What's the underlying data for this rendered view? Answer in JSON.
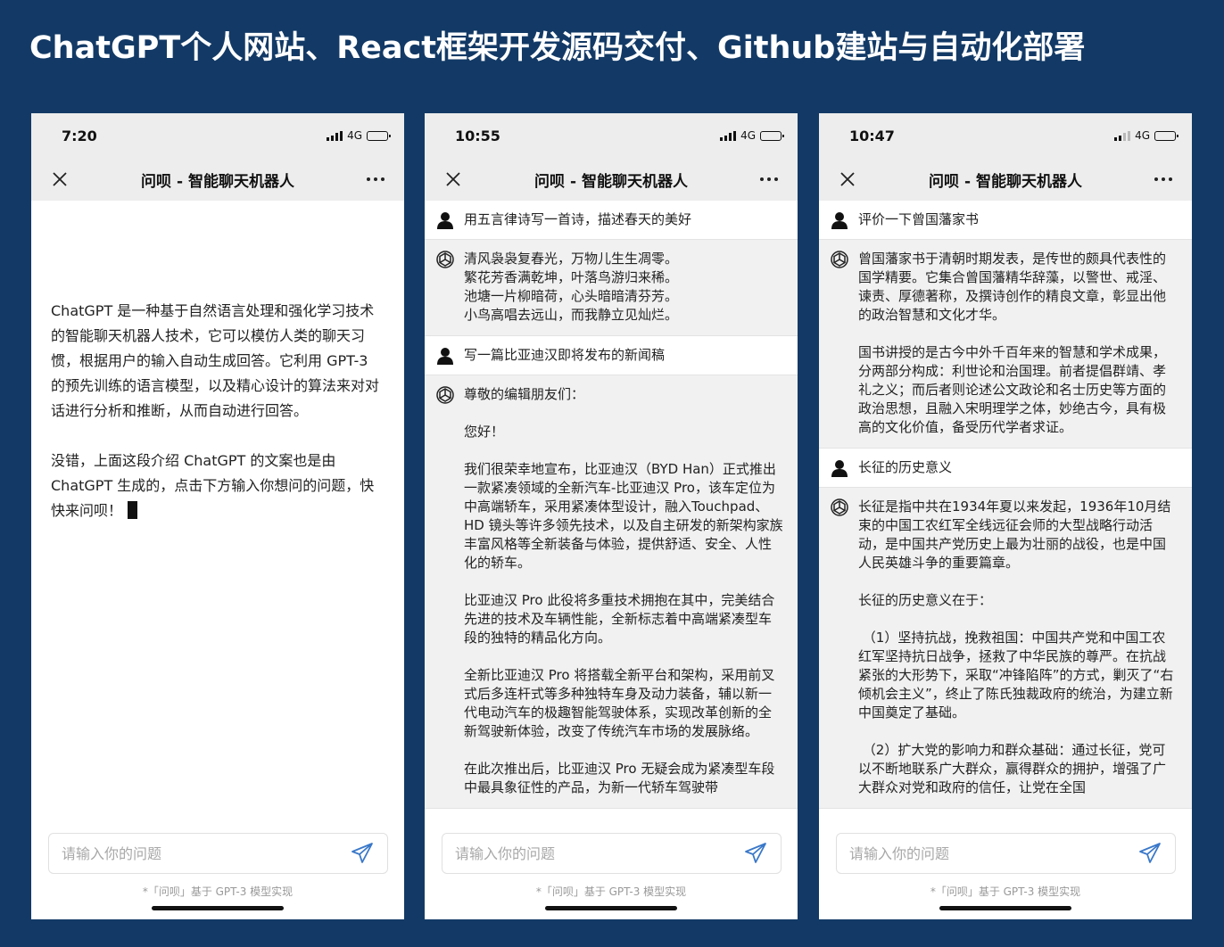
{
  "banner": {
    "title": "ChatGPT个人网站、React框架开发源码交付、Github建站与自动化部署"
  },
  "phones": [
    {
      "time": "7:20",
      "network": "4G",
      "signal": "full",
      "battery_level": 0.4,
      "nav_title": "问呗 - 智能聊天机器人",
      "intro": [
        "ChatGPT 是一种基于自然语言处理和强化学习技术的智能聊天机器人技术，它可以模仿人类的聊天习惯，根据用户的输入自动生成回答。它利用 GPT-3 的预先训练的语言模型，以及精心设计的算法来对对话进行分析和推断，从而自动进行回答。",
        "没错，上面这段介绍 ChatGPT 的文案也是由 ChatGPT 生成的，点击下方输入你想问的问题，快快来问呗！"
      ],
      "input_placeholder": "请输入你的问题",
      "footnote": "*「问呗」基于 GPT-3 模型实现"
    },
    {
      "time": "10:55",
      "network": "4G",
      "signal": "full",
      "battery_level": 0.35,
      "nav_title": "问呗 - 智能聊天机器人",
      "messages": [
        {
          "role": "user",
          "paragraphs": [
            "用五言律诗写一首诗，描述春天的美好"
          ]
        },
        {
          "role": "bot",
          "paragraphs": [
            "清风袅袅复春光，万物儿生生凋零。\n繁花芳香满乾坤，叶落鸟游归来稀。\n池塘一片柳暗荷，心头暗暗清芬芳。\n小鸟高唱去远山，而我静立见灿烂。"
          ]
        },
        {
          "role": "user",
          "paragraphs": [
            "写一篇比亚迪汉即将发布的新闻稿"
          ]
        },
        {
          "role": "bot",
          "paragraphs": [
            "尊敬的编辑朋友们：",
            "您好！",
            "我们很荣幸地宣布，比亚迪汉（BYD Han）正式推出一款紧凑领域的全新汽车-比亚迪汉 Pro，该车定位为中高端轿车，采用紧凑体型设计，融入Touchpad、HD 镜头等许多领先技术，以及自主研发的新架构家族丰富风格等全新装备与体验，提供舒适、安全、人性化的轿车。",
            "比亚迪汉 Pro 此役将多重技术拥抱在其中，完美结合先进的技术及车辆性能，全新标志着中高端紧凑型车段的独特的精品化方向。",
            "全新比亚迪汉 Pro 将搭载全新平台和架构，采用前叉式后多连杆式等多种独特车身及动力装备，辅以新一代电动汽车的极趣智能驾驶体系，实现改革创新的全新驾驶新体验，改变了传统汽车市场的发展脉络。",
            "在此次推出后，比亚迪汉 Pro 无疑会成为紧凑型车段中最具象征性的产品，为新一代轿车驾驶带"
          ]
        }
      ],
      "input_placeholder": "请输入你的问题",
      "footnote": "*「问呗」基于 GPT-3 模型实现"
    },
    {
      "time": "10:47",
      "network": "4G",
      "signal": "weak",
      "battery_level": 0.45,
      "nav_title": "问呗 - 智能聊天机器人",
      "messages": [
        {
          "role": "user",
          "paragraphs": [
            "评价一下曾国藩家书"
          ]
        },
        {
          "role": "bot",
          "paragraphs": [
            "曾国藩家书于清朝时期发表，是传世的颇具代表性的国学精要。它集合曾国藩精华辞藻，以警世、戒淫、谏责、厚德著称，及撰诗创作的精良文章，彰显出他的政治智慧和文化才华。",
            "国书讲授的是古今中外千百年来的智慧和学术成果，分两部分构成：利世论和治国理。前者提倡群靖、孝礼之义；而后者则论述公文政论和名士历史等方面的政治思想，且融入宋明理学之体，妙绝古今，具有极高的文化价值，备受历代学者求证。"
          ]
        },
        {
          "role": "user",
          "paragraphs": [
            "长征的历史意义"
          ]
        },
        {
          "role": "bot",
          "paragraphs": [
            "长征是指中共在1934年夏以来发起，1936年10月结束的中国工农红军全线远征会师的大型战略行动活动，是中国共产党历史上最为壮丽的战役，也是中国人民英雄斗争的重要篇章。",
            "长征的历史意义在于：",
            " （1）坚持抗战，挽救祖国：中国共产党和中国工农红军坚持抗日战争，拯救了中华民族的尊严。在抗战紧张的大形势下，采取“冲锋陷阵”的方式，剿灭了“右倾机会主义”，终止了陈氏独裁政府的统治，为建立新中国奠定了基础。",
            " （2）扩大党的影响力和群众基础：通过长征，党可以不断地联系广大群众，赢得群众的拥护，增强了广大群众对党和政府的信任，让党在全国"
          ]
        }
      ],
      "input_placeholder": "请输入你的问题",
      "footnote": "*「问呗」基于 GPT-3 模型实现"
    }
  ]
}
